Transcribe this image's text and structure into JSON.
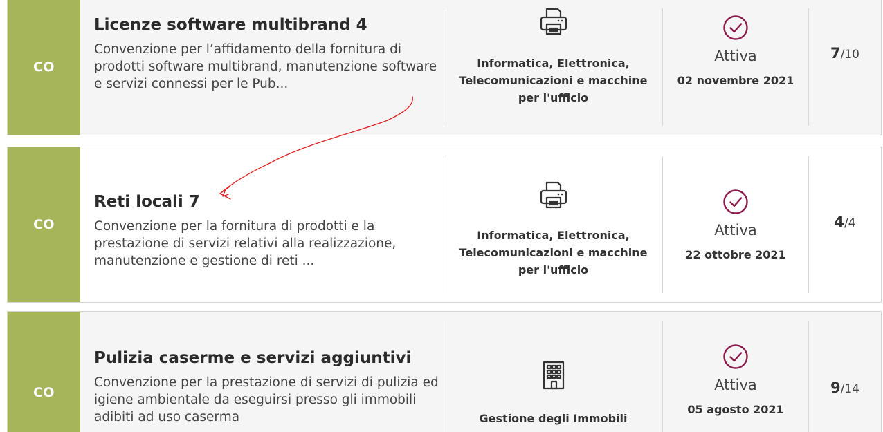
{
  "items": [
    {
      "type": "CO",
      "title": "Licenze software multibrand 4",
      "description": "Convenzione per l’affidamento della fornitura di prodotti software multibrand, manutenzione software e servizi connessi per le Pub...",
      "category_icon": "printer-icon",
      "category": "Informatica, Elettronica, Telecomunicazioni e macchine per l'ufficio",
      "status_icon": "check-circle-icon",
      "status": "Attiva",
      "date": "02 novembre 2021",
      "count": "7",
      "total": "/10"
    },
    {
      "type": "CO",
      "title": "Reti locali 7",
      "description": "Convenzione per la fornitura di prodotti e la prestazione di servizi relativi alla realizzazione, manutenzione e gestione di reti ...",
      "category_icon": "printer-icon",
      "category": "Informatica, Elettronica, Telecomunicazioni e macchine per l'ufficio",
      "status_icon": "check-circle-icon",
      "status": "Attiva",
      "date": "22 ottobre 2021",
      "count": "4",
      "total": "/4"
    },
    {
      "type": "CO",
      "title": "Pulizia caserme e servizi aggiuntivi",
      "description": "Convenzione per la prestazione di servizi di pulizia ed igiene ambientale da eseguirsi presso gli immobili adibiti ad uso caserma",
      "category_icon": "building-icon",
      "category": "Gestione degli Immobili",
      "status_icon": "check-circle-icon",
      "status": "Attiva",
      "date": "05 agosto 2021",
      "count": "9",
      "total": "/14"
    }
  ],
  "colors": {
    "type_badge": "#a6b55a",
    "status_icon": "#8b1a4a",
    "annotation": "#e02020"
  }
}
